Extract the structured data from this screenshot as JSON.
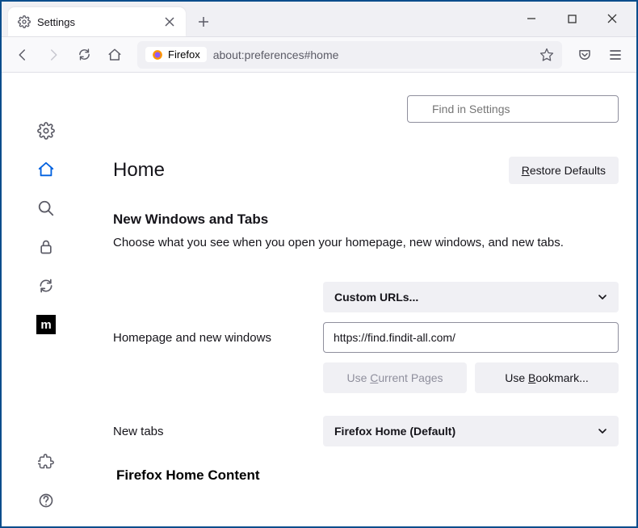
{
  "tab": {
    "title": "Settings"
  },
  "urlbar": {
    "prefix": "Firefox",
    "url": "about:preferences#home"
  },
  "search": {
    "placeholder": "Find in Settings"
  },
  "page": {
    "heading": "Home",
    "restore": "Restore Defaults",
    "section_title": "New Windows and Tabs",
    "section_sub": "Choose what you see when you open your homepage, new windows, and new tabs."
  },
  "homepage": {
    "label": "Homepage and new windows",
    "dropdown": "Custom URLs...",
    "url_value": "https://find.findit-all.com/",
    "use_current_a": "Use ",
    "use_current_b": "C",
    "use_current_c": "urrent Pages",
    "use_bookmark_a": "Use ",
    "use_bookmark_b": "B",
    "use_bookmark_c": "ookmark..."
  },
  "newtabs": {
    "label": "New tabs",
    "dropdown": "Firefox Home (Default)"
  },
  "footer_heading": "Firefox Home Content",
  "restore_a": "R",
  "restore_b": "estore Defaults"
}
